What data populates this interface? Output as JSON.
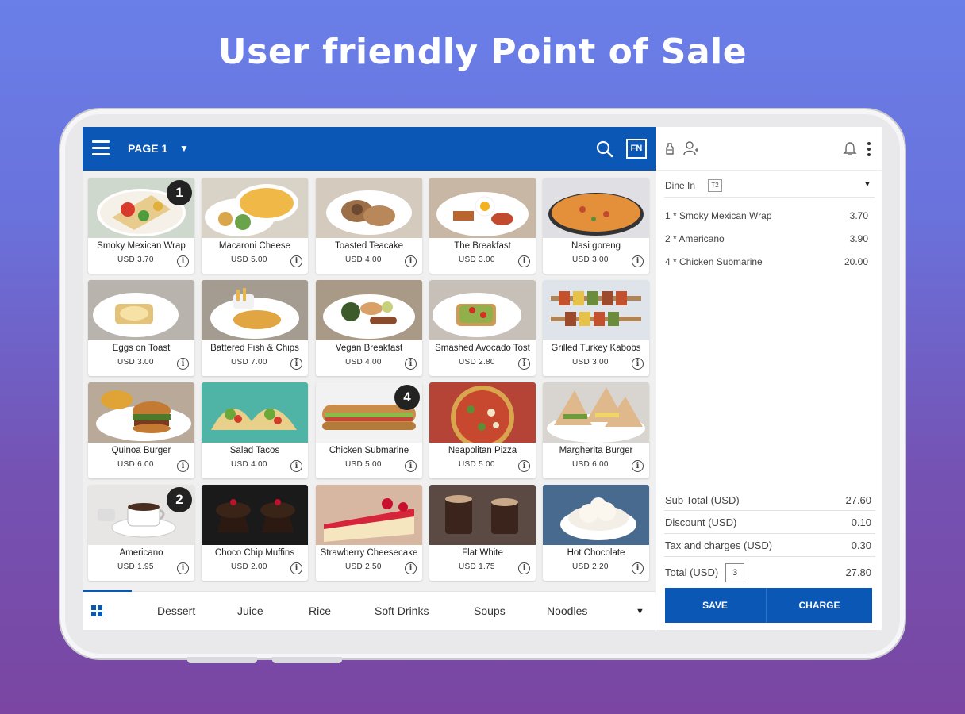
{
  "headline": "User friendly Point of Sale",
  "topbar": {
    "page_label": "PAGE 1",
    "fn_label": "FN"
  },
  "products": [
    {
      "name": "Smoky Mexican Wrap",
      "price": "USD  3.70",
      "qty": "1",
      "bg": "#cfd8cc",
      "dish": "wrap"
    },
    {
      "name": "Macaroni Cheese",
      "price": "USD 5.00",
      "qty": "",
      "bg": "#d9d2c6",
      "dish": "mac"
    },
    {
      "name": "Toasted Teacake",
      "price": "USD   4.00",
      "qty": "",
      "bg": "#d4cabd",
      "dish": "tea"
    },
    {
      "name": "The Breakfast",
      "price": "USD   3.00",
      "qty": "",
      "bg": "#c8b7a4",
      "dish": "brk"
    },
    {
      "name": "Nasi goreng",
      "price": "USD   3.00",
      "qty": "",
      "bg": "#e0dfe4",
      "dish": "nasi"
    },
    {
      "name": "Eggs on Toast",
      "price": "USD    3.00",
      "qty": "",
      "bg": "#b9b3ad",
      "dish": "egg"
    },
    {
      "name": "Battered Fish & Chips",
      "price": "USD   7.00",
      "qty": "",
      "bg": "#a59c91",
      "dish": "fish"
    },
    {
      "name": "Vegan Breakfast",
      "price": "USD   4.00",
      "qty": "",
      "bg": "#a89a86",
      "dish": "vegan"
    },
    {
      "name": "Smashed Avocado Tost",
      "price": "USD   2.80",
      "qty": "",
      "bg": "#c6c0b9",
      "dish": "avo"
    },
    {
      "name": "Grilled Turkey Kabobs",
      "price": "USD    3.00",
      "qty": "",
      "bg": "#dfe4ea",
      "dish": "kabob"
    },
    {
      "name": "Quinoa Burger",
      "price": "USD   6.00",
      "qty": "",
      "bg": "#b8a999",
      "dish": "burger"
    },
    {
      "name": "Salad Tacos",
      "price": "USD   4.00",
      "qty": "",
      "bg": "#4fb3a6",
      "dish": "taco"
    },
    {
      "name": "Chicken Submarine",
      "price": "USD   5.00",
      "qty": "4",
      "bg": "#f2f2f2",
      "dish": "sub"
    },
    {
      "name": "Neapolitan Pizza",
      "price": "USD   5.00",
      "qty": "",
      "bg": "#b64436",
      "dish": "pizza"
    },
    {
      "name": "Margherita Burger",
      "price": "USD   6.00",
      "qty": "",
      "bg": "#d8d4d0",
      "dish": "sand"
    },
    {
      "name": "Americano",
      "price": "USD   1.95",
      "qty": "2",
      "bg": "#e7e6e4",
      "dish": "coffee"
    },
    {
      "name": "Choco Chip Muffins",
      "price": "USD  2.00",
      "qty": "",
      "bg": "#1a1a1a",
      "dish": "muffin"
    },
    {
      "name": "Strawberry Cheesecake",
      "price": "USD  2.50",
      "qty": "",
      "bg": "#d8b7a2",
      "dish": "cake"
    },
    {
      "name": "Flat White",
      "price": "USD   1.75",
      "qty": "",
      "bg": "#5b4a43",
      "dish": "flat"
    },
    {
      "name": "Hot Chocolate",
      "price": "USD  2.20",
      "qty": "",
      "bg": "#486a8f",
      "dish": "hotchoc"
    }
  ],
  "categories": [
    "Dessert",
    "Juice",
    "Rice",
    "Soft Drinks",
    "Soups",
    "Noodles"
  ],
  "order": {
    "dine_label": "Dine In",
    "table": "T2",
    "lines": [
      {
        "label": "1 * Smoky Mexican Wrap",
        "amount": "3.70"
      },
      {
        "label": "2 * Americano",
        "amount": "3.90"
      },
      {
        "label": "4 * Chicken Submarine",
        "amount": "20.00"
      }
    ],
    "subtotal_label": "Sub Total (USD)",
    "subtotal": "27.60",
    "discount_label": "Discount (USD)",
    "discount": "0.10",
    "tax_label": "Tax and charges (USD)",
    "tax": "0.30",
    "total_label": "Total (USD)",
    "guests": "3",
    "total": "27.80",
    "save_label": "SAVE",
    "charge_label": "CHARGE"
  },
  "colors": {
    "primary": "#0b57b5",
    "bg_top": "#6a7fe8",
    "bg_bottom": "#7a46a2"
  }
}
